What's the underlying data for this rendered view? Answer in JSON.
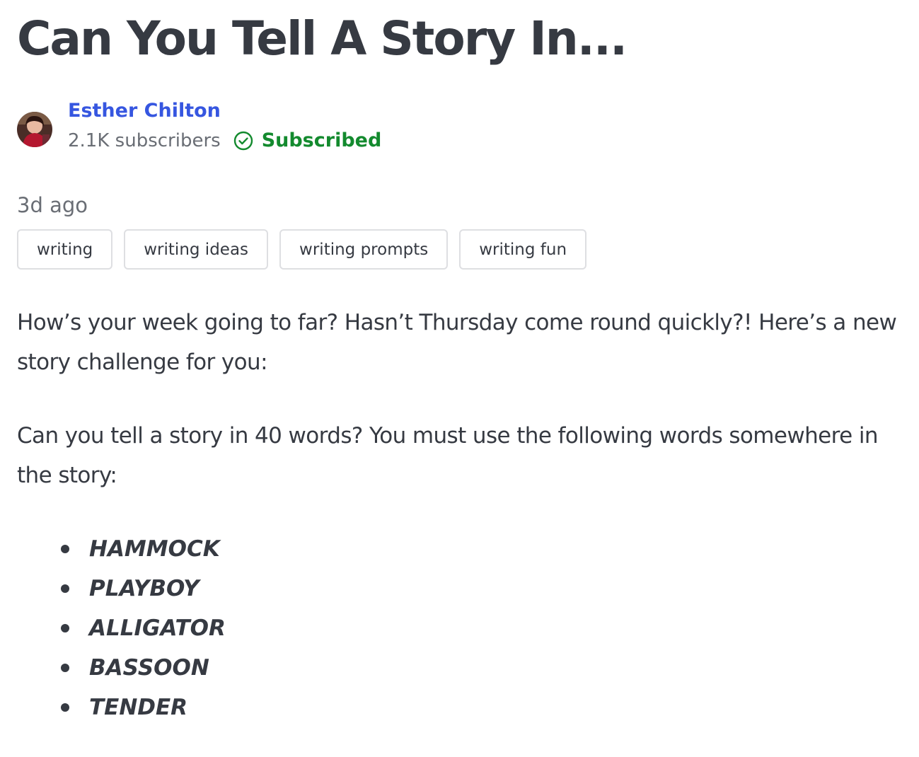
{
  "post": {
    "title": "Can You Tell A Story In...",
    "date": "3d ago"
  },
  "author": {
    "name": "Esther Chilton",
    "subscribers": "2.1K subscribers",
    "subscribed_label": "Subscribed",
    "avatar_icon": "author-photo"
  },
  "tags": [
    "writing",
    "writing ideas",
    "writing prompts",
    "writing fun"
  ],
  "body": {
    "paragraph_1": "How’s your week going to far? Hasn’t Thursday come round quickly?! Here’s a new story challenge for you:",
    "paragraph_2": "Can you tell a story in 40 words? You must use the following words somewhere in the story:"
  },
  "words": [
    "HAMMOCK",
    "PLAYBOY",
    "ALLIGATOR",
    "BASSOON",
    "TENDER"
  ],
  "colors": {
    "link": "#3656e0",
    "subscribed": "#138a2e",
    "text": "#363a42",
    "muted": "#6a6e75",
    "tag_border": "#dedfe2"
  },
  "icons": {
    "subscribed": "check-circle-icon",
    "bullet": "bullet-icon"
  }
}
